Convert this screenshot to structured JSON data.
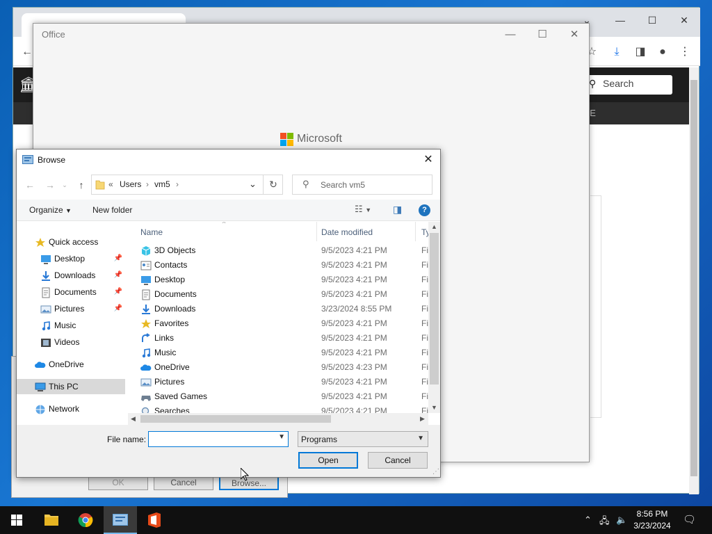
{
  "office": {
    "title": "Office",
    "logo_text": "Microsoft"
  },
  "chrome": {
    "search_label": "Search",
    "nav_fragment": "LE"
  },
  "lower_dialog": {
    "ok_label": "OK",
    "cancel_label": "Cancel",
    "browse_label": "Browse..."
  },
  "browse": {
    "title": "Browse",
    "address": {
      "prefix": "«",
      "parts": [
        "Users",
        "vm5"
      ]
    },
    "search_placeholder": "Search vm5",
    "organize_label": "Organize",
    "new_folder_label": "New folder",
    "help_label": "?",
    "nav": [
      {
        "label": "Quick access",
        "icon": "star-icon",
        "pinned": false
      },
      {
        "label": "Desktop",
        "icon": "desktop-icon",
        "pinned": true
      },
      {
        "label": "Downloads",
        "icon": "download-icon",
        "pinned": true
      },
      {
        "label": "Documents",
        "icon": "documents-icon",
        "pinned": true
      },
      {
        "label": "Pictures",
        "icon": "pictures-icon",
        "pinned": true
      },
      {
        "label": "Music",
        "icon": "music-icon",
        "pinned": false
      },
      {
        "label": "Videos",
        "icon": "videos-icon",
        "pinned": false
      },
      {
        "label": "OneDrive",
        "icon": "onedrive-icon",
        "pinned": false
      },
      {
        "label": "This PC",
        "icon": "pc-icon",
        "pinned": false,
        "selected": true
      },
      {
        "label": "Network",
        "icon": "network-icon",
        "pinned": false
      }
    ],
    "columns": {
      "name": "Name",
      "date": "Date modified",
      "type": "Ty"
    },
    "files": [
      {
        "name": "3D Objects",
        "date": "9/5/2023 4:21 PM",
        "type": "Fi",
        "icon": "3d-objects-icon"
      },
      {
        "name": "Contacts",
        "date": "9/5/2023 4:21 PM",
        "type": "Fi",
        "icon": "contacts-icon"
      },
      {
        "name": "Desktop",
        "date": "9/5/2023 4:21 PM",
        "type": "Fi",
        "icon": "desktop-icon"
      },
      {
        "name": "Documents",
        "date": "9/5/2023 4:21 PM",
        "type": "Fi",
        "icon": "documents-icon"
      },
      {
        "name": "Downloads",
        "date": "3/23/2024 8:55 PM",
        "type": "Fi",
        "icon": "download-icon"
      },
      {
        "name": "Favorites",
        "date": "9/5/2023 4:21 PM",
        "type": "Fi",
        "icon": "star-icon"
      },
      {
        "name": "Links",
        "date": "9/5/2023 4:21 PM",
        "type": "Fi",
        "icon": "links-icon"
      },
      {
        "name": "Music",
        "date": "9/5/2023 4:21 PM",
        "type": "Fi",
        "icon": "music-icon"
      },
      {
        "name": "OneDrive",
        "date": "9/5/2023 4:23 PM",
        "type": "Fi",
        "icon": "onedrive-icon"
      },
      {
        "name": "Pictures",
        "date": "9/5/2023 4:21 PM",
        "type": "Fi",
        "icon": "pictures-icon"
      },
      {
        "name": "Saved Games",
        "date": "9/5/2023 4:21 PM",
        "type": "Fi",
        "icon": "saved-games-icon"
      },
      {
        "name": "Searches",
        "date": "9/5/2023 4:21 PM",
        "type": "Fi",
        "icon": "search-icon"
      }
    ],
    "filename_label": "File name:",
    "filename_value": "",
    "filetype_value": "Programs",
    "open_label": "Open",
    "cancel_label": "Cancel"
  },
  "taskbar": {
    "time": "8:56 PM",
    "date": "3/23/2024",
    "apps": [
      "file-explorer-icon",
      "chrome-icon",
      "browse-dialog-icon",
      "office-icon"
    ]
  },
  "colors": {
    "accent": "#0078d7",
    "taskbar": "#101010",
    "desktop": "#1976d2"
  }
}
